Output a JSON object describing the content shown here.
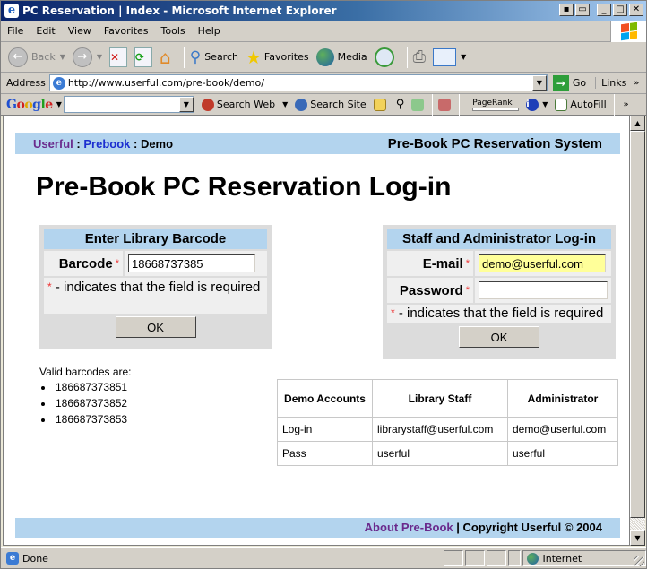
{
  "window": {
    "title": "PC Reservation | Index - Microsoft Internet Explorer"
  },
  "menu": [
    "File",
    "Edit",
    "View",
    "Favorites",
    "Tools",
    "Help"
  ],
  "toolbar": {
    "back": "Back",
    "search": "Search",
    "favorites": "Favorites",
    "media": "Media"
  },
  "address": {
    "label": "Address",
    "url": "http://www.userful.com/pre-book/demo/",
    "go": "Go",
    "links": "Links"
  },
  "google_bar": {
    "logo": "Google",
    "search_value": "",
    "search_web": "Search Web",
    "search_site": "Search Site",
    "pagerank": "PageRank",
    "autofill": "AutoFill"
  },
  "page": {
    "breadcrumb": {
      "userful": "Userful",
      "sep1": " : ",
      "prebook": "Prebook",
      "sep2": " : ",
      "current": "Demo"
    },
    "system_title": "Pre-Book PC Reservation System",
    "heading": "Pre-Book PC Reservation Log-in",
    "barcode_box": {
      "title": "Enter Library Barcode",
      "label": "Barcode",
      "required_mark": "*",
      "value": "18668737385",
      "note": " - indicates that the field is required",
      "ok": "OK"
    },
    "staff_box": {
      "title": "Staff and Administrator Log-in",
      "email_label": "E-mail",
      "email_value": "demo@userful.com",
      "password_label": "Password",
      "password_value": "",
      "required_mark": "*",
      "note": " - indicates that the field is required",
      "ok": "OK"
    },
    "valid_barcodes": {
      "label": "Valid barcodes are:",
      "items": [
        "186687373851",
        "186687373852",
        "186687373853"
      ]
    },
    "demo_table": {
      "headers": [
        "Demo Accounts",
        "Library Staff",
        "Administrator"
      ],
      "rows": [
        [
          "Log-in",
          "librarystaff@userful.com",
          "demo@userful.com"
        ],
        [
          "Pass",
          "userful",
          "userful"
        ]
      ]
    },
    "footer": {
      "about": "About Pre-Book",
      "copyright": " | Copyright Userful © 2004"
    }
  },
  "status": {
    "text": "Done",
    "zone": "Internet"
  },
  "colors": {
    "header_band": "#b3d4ee",
    "visited_link": "#6a2a8c",
    "link": "#1c2fd0",
    "required": "#e33333",
    "autofill_yellow": "#ffff99"
  }
}
